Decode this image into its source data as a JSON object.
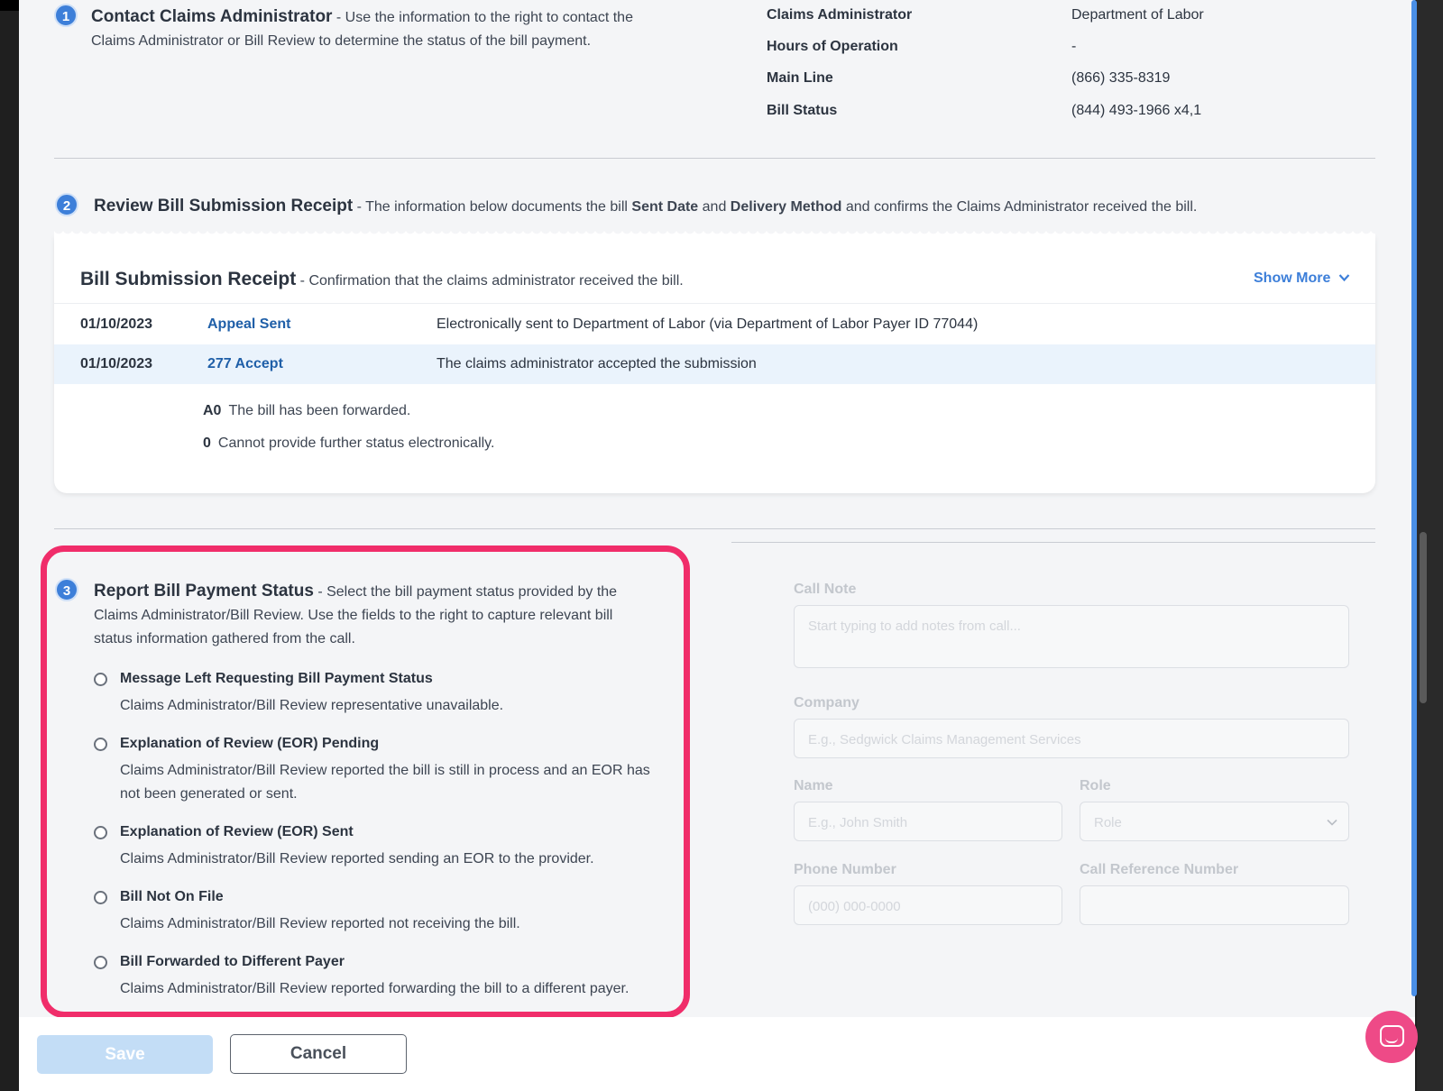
{
  "step1": {
    "number": "1",
    "title": "Contact Claims Administrator",
    "desc_line1": " - Use the information to the right to contact the",
    "desc_line2": "Claims Administrator or Bill Review to determine the status of the bill payment.",
    "info": [
      {
        "label": "Claims Administrator",
        "value": "Department of Labor"
      },
      {
        "label": "Hours of Operation",
        "value": "-"
      },
      {
        "label": "Main Line",
        "value": "(866) 335-8319"
      },
      {
        "label": "Bill Status",
        "value": "(844) 493-1966 x4,1"
      }
    ]
  },
  "step2": {
    "number": "2",
    "title": "Review Bill Submission Receipt",
    "desc_a": " - The information below documents the bill ",
    "desc_b": "Sent Date",
    "desc_c": " and ",
    "desc_d": "Delivery Method",
    "desc_e": " and confirms the Claims Administrator received the bill."
  },
  "receipt": {
    "title": "Bill Submission Receipt",
    "subtitle": " - Confirmation that the claims administrator received the bill.",
    "show_more": "Show More",
    "rows": [
      {
        "date": "01/10/2023",
        "event": "Appeal Sent",
        "text": "Electronically sent to Department of Labor (via Department of Labor Payer ID 77044)"
      },
      {
        "date": "01/10/2023",
        "event": "277 Accept",
        "text": "The claims administrator accepted the submission"
      }
    ],
    "codes": [
      {
        "code": "A0",
        "text": "The bill has been forwarded."
      },
      {
        "code": "0",
        "text": "Cannot provide further status electronically."
      }
    ]
  },
  "step3": {
    "number": "3",
    "title": "Report Bill Payment Status",
    "desc_line1": " - Select the bill payment status provided by the",
    "desc_line2": "Claims Administrator/Bill Review. Use the fields to the right to capture relevant bill",
    "desc_line3": "status information gathered from the call.",
    "options": [
      {
        "title": "Message Left Requesting Bill Payment Status",
        "desc": "Claims Administrator/Bill Review representative unavailable."
      },
      {
        "title": "Explanation of Review (EOR) Pending",
        "desc": "Claims Administrator/Bill Review reported the bill is still in process and an EOR has not been generated or sent."
      },
      {
        "title": "Explanation of Review (EOR) Sent",
        "desc": "Claims Administrator/Bill Review reported sending an EOR to the provider."
      },
      {
        "title": "Bill Not On File",
        "desc": "Claims Administrator/Bill Review reported not receiving the bill."
      },
      {
        "title": "Bill Forwarded to Different Payer",
        "desc": "Claims Administrator/Bill Review reported forwarding the bill to a different payer."
      }
    ]
  },
  "form": {
    "call_note_label": "Call Note",
    "call_note_placeholder": "Start typing to add notes from call...",
    "company_label": "Company",
    "company_placeholder": "E.g., Sedgwick Claims Management Services",
    "name_label": "Name",
    "name_placeholder": "E.g., John Smith",
    "role_label": "Role",
    "role_placeholder": "Role",
    "phone_label": "Phone Number",
    "phone_placeholder": "(000) 000-0000",
    "callref_label": "Call Reference Number",
    "callref_placeholder": ""
  },
  "footer": {
    "save_label": "Save",
    "cancel_label": "Cancel"
  },
  "colors": {
    "accent": "#3d7fd9",
    "highlight": "#f02d6a",
    "chat": "#ee4a87"
  }
}
